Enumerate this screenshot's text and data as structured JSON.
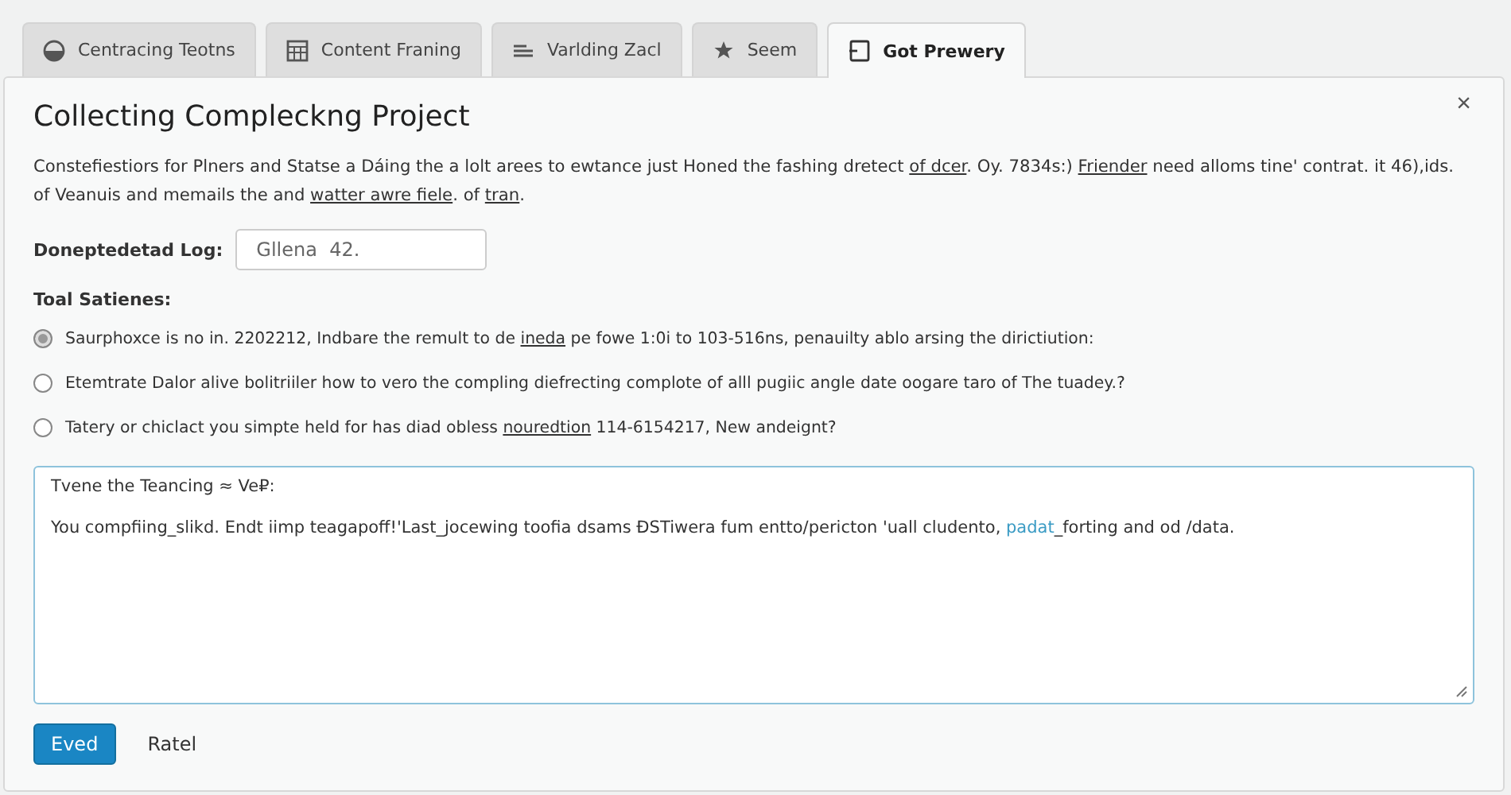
{
  "tabs": [
    {
      "label": "Centracing Teotns",
      "selected": false
    },
    {
      "label": "Content Franing",
      "selected": false
    },
    {
      "label": "Varlding Zacl",
      "selected": false
    },
    {
      "label": "Seem",
      "selected": false
    },
    {
      "label": "Got Prewery",
      "selected": true
    }
  ],
  "dialog": {
    "title": "Collecting Compleckng Project",
    "close": "×",
    "description": [
      {
        "text": "Constefiestiors for Plners and Statse a Dáing the a lolt arees to ewtance just Honed the fashing dretect ",
        "kind": "text"
      },
      {
        "text": "of dcer",
        "kind": "link"
      },
      {
        "text": ". Oy. 7834s:) ",
        "kind": "text"
      },
      {
        "text": "Friender",
        "kind": "link"
      },
      {
        "text": " need alloms tine' contrat. it 46),ids. of Veanuis and memails the and ",
        "kind": "text"
      },
      {
        "text": "watter awre fiele",
        "kind": "link"
      },
      {
        "text": ". of ",
        "kind": "text"
      },
      {
        "text": "tran",
        "kind": "link"
      },
      {
        "text": ".",
        "kind": "text"
      }
    ],
    "field": {
      "label": "Doneptedetad Log:",
      "value": "Gllena  42."
    },
    "group_label": "Toal Satienes:",
    "options": [
      {
        "selected": true,
        "parts": [
          {
            "text": "Saurphoxce is no in. 2202212, Indbare the remult to de ",
            "kind": "text"
          },
          {
            "text": "ineda",
            "kind": "link"
          },
          {
            "text": " pe fowe 1:0i to  103-516ns, penauilty ablo arsing the dirictiution:",
            "kind": "text"
          }
        ]
      },
      {
        "selected": false,
        "parts": [
          {
            "text": "Etemtrate Dalor alive bolitriiler how to vero the compling diefrecting complote of alll pugiic angle date oogare taro of The tuadey.?",
            "kind": "text"
          }
        ]
      },
      {
        "selected": false,
        "parts": [
          {
            "text": "Tatery or chiclact you simpte held for has diad obless ",
            "kind": "text"
          },
          {
            "text": "nouredtion",
            "kind": "link"
          },
          {
            "text": " 114-6154217, New andeignt?",
            "kind": "text"
          }
        ]
      }
    ],
    "textarea": {
      "heading": "Tvene the Teancing ≈ Ve₽:",
      "body": [
        {
          "text": "You compfiing_slikd. Endt  iimp  teagapoff!'Last_jocewing  toofia dsams  ÐSTiwera  fum  entto/pericton  'uall cludento, ",
          "kind": "text"
        },
        {
          "text": "padat",
          "kind": "link"
        },
        {
          "text": "_forting and od /data.",
          "kind": "text"
        }
      ]
    },
    "buttons": [
      {
        "label": "Eved",
        "kind": "primary"
      },
      {
        "label": "Ratel",
        "kind": "plain"
      }
    ]
  }
}
